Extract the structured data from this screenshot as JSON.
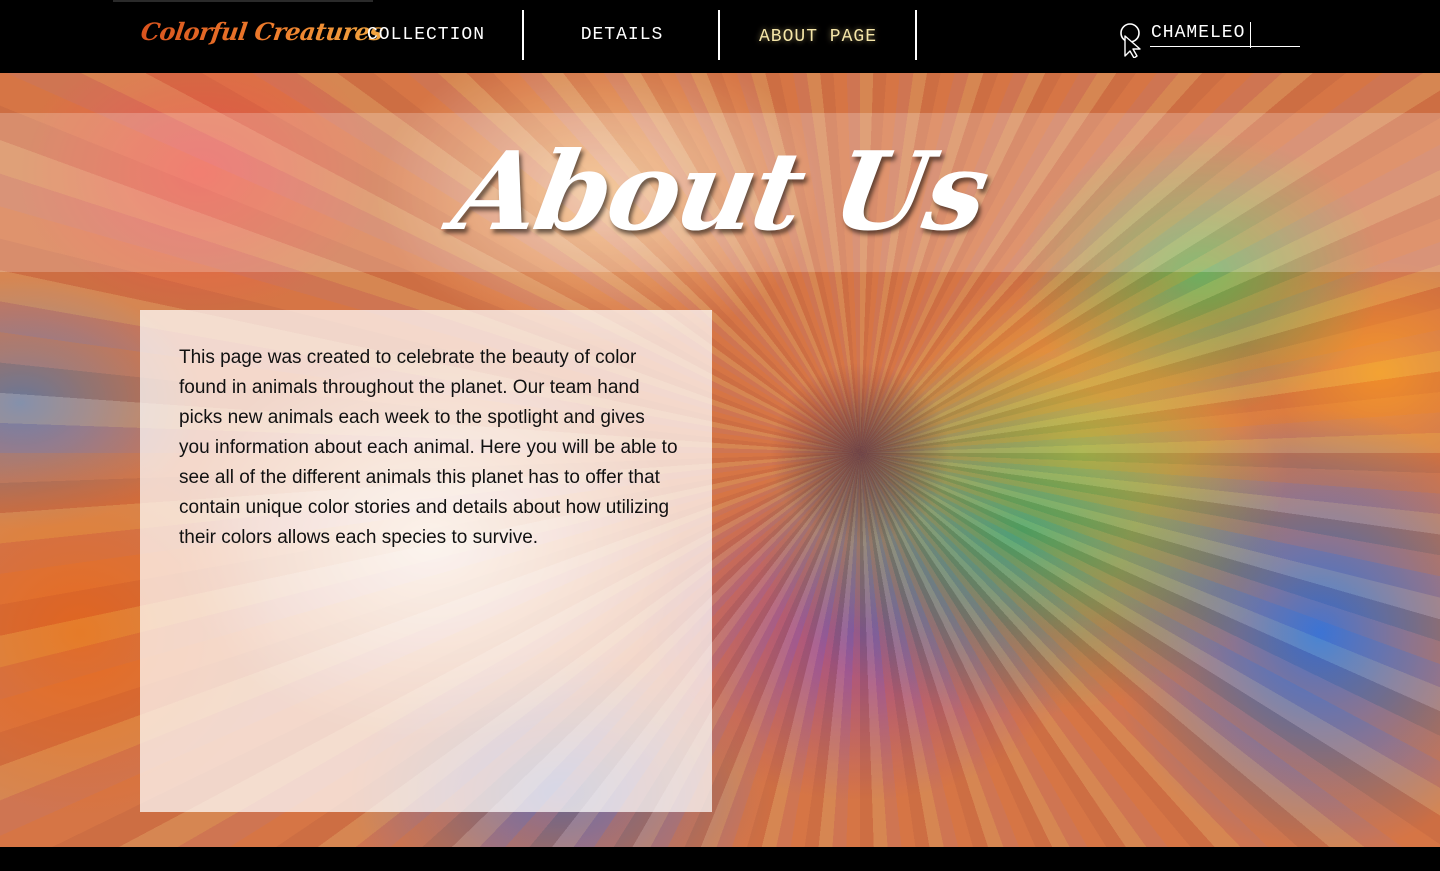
{
  "header": {
    "logo_text": "Colorful Creatures",
    "nav": [
      {
        "label": "COLLECTION",
        "active": false
      },
      {
        "label": "DETAILS",
        "active": false
      },
      {
        "label": "ABOUT PAGE",
        "active": true
      }
    ],
    "search": {
      "value": "CHAMELEO",
      "icon": "search-icon"
    }
  },
  "hero": {
    "title": "About Us"
  },
  "about": {
    "body": "This page was created to celebrate the beauty of color found in animals throughout the planet. Our team hand picks new animals each week to the spotlight and gives you information about each animal. Here you will be able to see all of the different animals this planet has to offer that contain unique color stories and details about how utilizing their colors allows each species to survive."
  },
  "colors": {
    "header_bg": "#000000",
    "nav_text": "#ffffff",
    "nav_active": "#f5e6a8",
    "logo_gradient_start": "#d9531e",
    "logo_gradient_end": "#f1a640"
  }
}
